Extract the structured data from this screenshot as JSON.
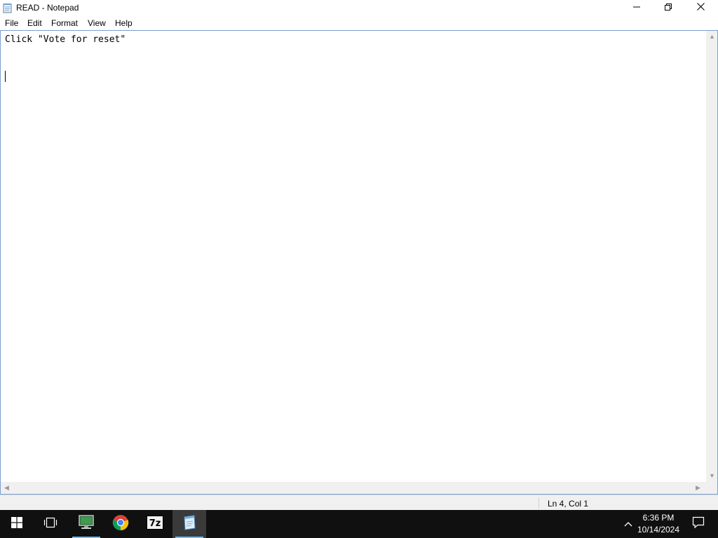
{
  "window": {
    "title": "READ - Notepad",
    "icon": "notepad-icon",
    "controls": [
      "minimize-icon",
      "restore-icon",
      "close-icon"
    ]
  },
  "menu": {
    "file": "File",
    "edit": "Edit",
    "format": "Format",
    "view": "View",
    "help": "Help"
  },
  "editor": {
    "content": "Click \"Vote for reset\"",
    "caret_line": 4
  },
  "status": {
    "position": "Ln 4, Col 1"
  },
  "taskbar": {
    "icons": [
      "windows-start-icon",
      "task-view-icon",
      "computer-monitor-icon",
      "chrome-icon",
      "7zip-icon",
      "notepad-icon"
    ],
    "active": "notepad-icon",
    "time": "6:36 PM",
    "date": "10/14/2024"
  },
  "colors": {
    "taskbar_bg": "#101010",
    "active_indicator": "#76b9ed",
    "editor_border": "#7a9fd1"
  }
}
